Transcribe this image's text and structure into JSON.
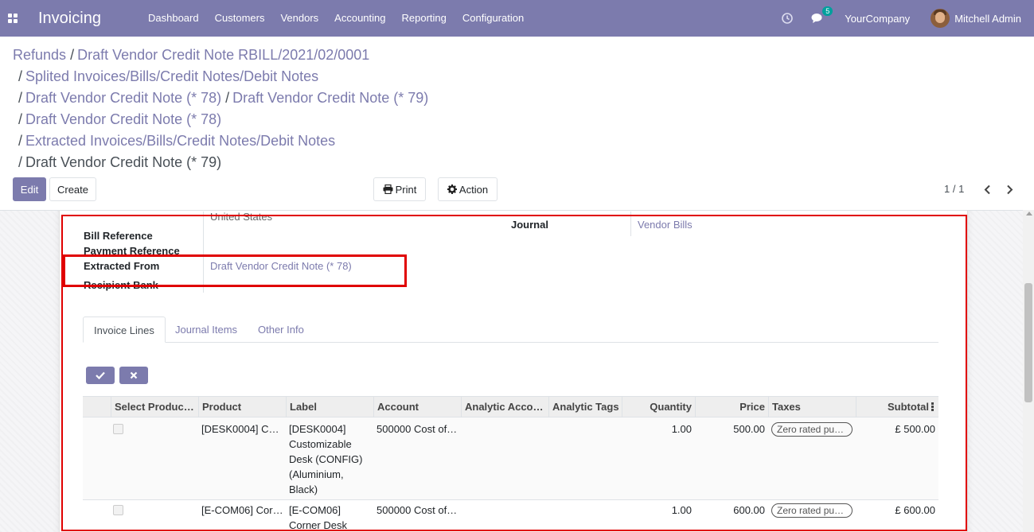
{
  "navbar": {
    "app_title": "Invoicing",
    "menu": [
      "Dashboard",
      "Customers",
      "Vendors",
      "Accounting",
      "Reporting",
      "Configuration"
    ],
    "chat_count": "5",
    "company": "YourCompany",
    "user": "Mitchell Admin"
  },
  "breadcrumbs": {
    "line1": {
      "first": "Refunds",
      "second": "Draft Vendor Credit Note RBILL/2021/02/0001"
    },
    "line2": "Splited Invoices/Bills/Credit Notes/Debit Notes",
    "line3": {
      "first": "Draft Vendor Credit Note (* 78)",
      "second": "Draft Vendor Credit Note (* 79)"
    },
    "line4": "Draft Vendor Credit Note (* 78)",
    "line5": "Extracted Invoices/Bills/Credit Notes/Debit Notes",
    "line6": "Draft Vendor Credit Note (* 79)",
    "separator": "/"
  },
  "control_panel": {
    "edit": "Edit",
    "create": "Create",
    "print": "Print",
    "action": "Action",
    "pager": "1 / 1"
  },
  "form": {
    "partial_address": "United States",
    "bill_reference_label": "Bill Reference",
    "payment_reference_label": "Payment Reference",
    "extracted_from_label": "Extracted From",
    "extracted_from_value": "Draft Vendor Credit Note (* 78)",
    "recipient_bank_label": "Recipient Bank",
    "journal_label": "Journal",
    "journal_value": "Vendor Bills"
  },
  "tabs": [
    "Invoice Lines",
    "Journal Items",
    "Other Info"
  ],
  "table": {
    "headers": [
      "Select Produc…",
      "Product",
      "Label",
      "Account",
      "Analytic Acco…",
      "Analytic Tags",
      "Quantity",
      "Price",
      "Taxes",
      "Subtotal"
    ],
    "rows": [
      {
        "product": "[DESK0004] C…",
        "label": "[DESK0004] Customizable Desk (CONFIG) (Aluminium, Black)",
        "account": "500000 Cost of…",
        "quantity": "1.00",
        "price": "500.00",
        "taxes": "Zero rated pur…",
        "subtotal": "£ 500.00"
      },
      {
        "product": "[E-COM06] Cor…",
        "label": "[E-COM06] Corner Desk",
        "account": "500000 Cost of…",
        "quantity": "1.00",
        "price": "600.00",
        "taxes": "Zero rated pur…",
        "subtotal": "£ 600.00"
      }
    ]
  },
  "colors": {
    "brand": "#7c7bad",
    "highlight": "#e00000",
    "tax_badge": "#555555"
  }
}
